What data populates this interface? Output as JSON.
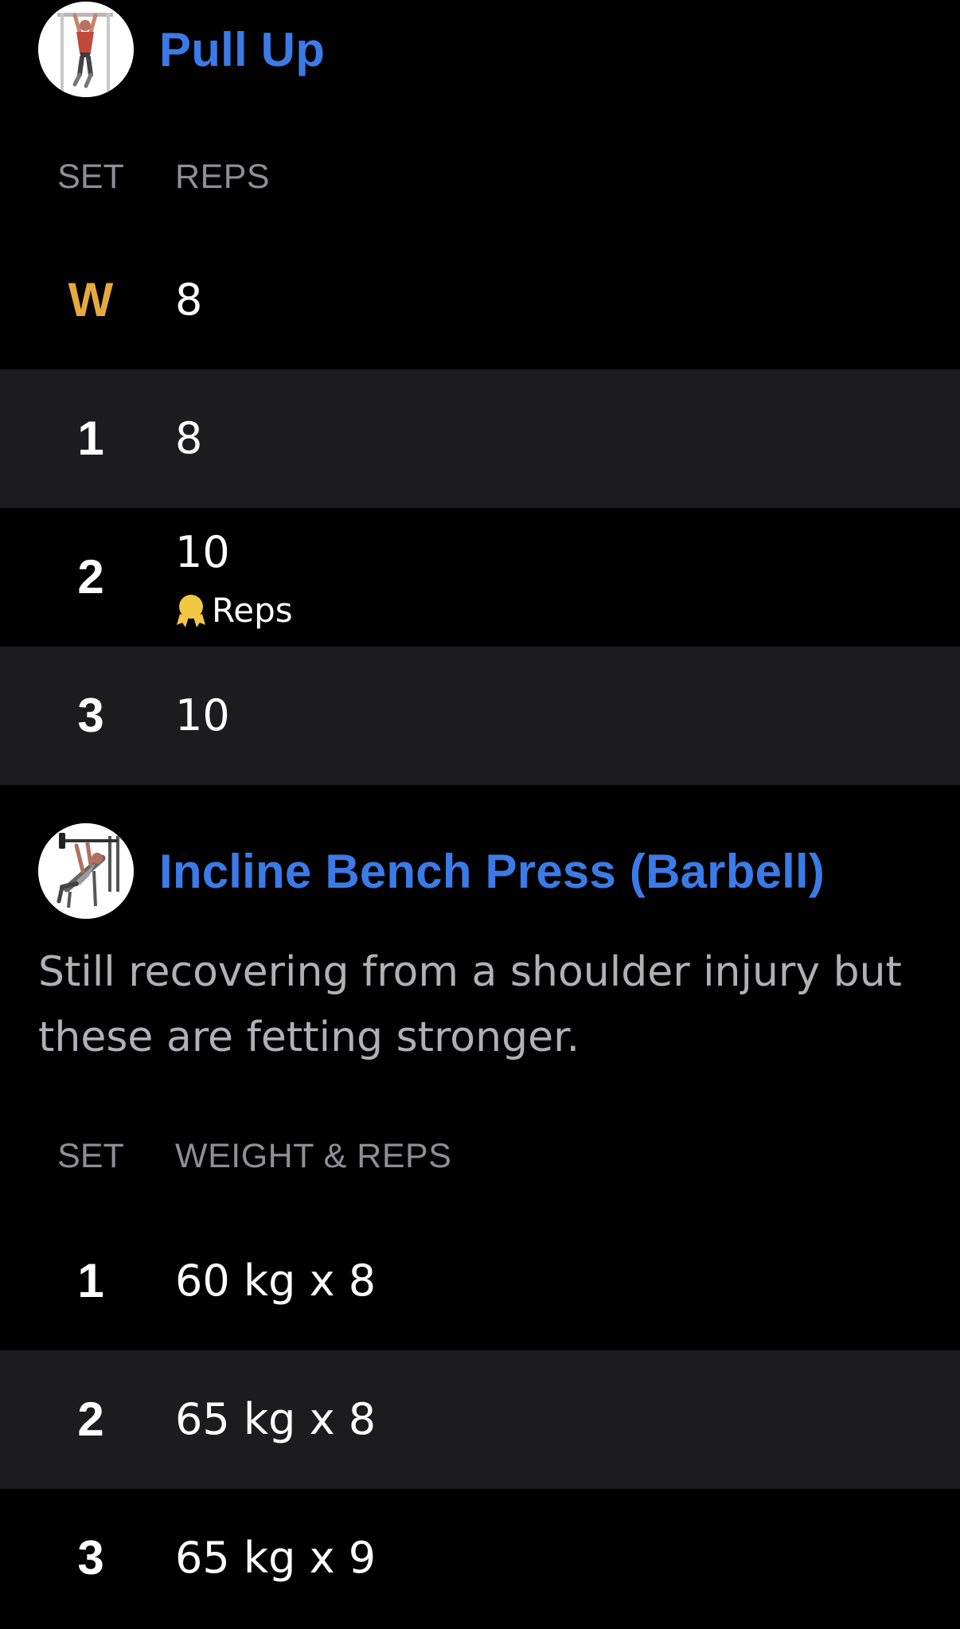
{
  "exercises": [
    {
      "title": "Pull Up",
      "thumbnail_icon": "pull-up-figure-icon",
      "columns": {
        "set": "SET",
        "value": "REPS"
      },
      "sets": [
        {
          "set": "W",
          "value": "8"
        },
        {
          "set": "1",
          "value": "8"
        },
        {
          "set": "2",
          "value": "10",
          "pr_label": "Reps"
        },
        {
          "set": "3",
          "value": "10"
        }
      ]
    },
    {
      "title": "Incline Bench Press (Barbell)",
      "thumbnail_icon": "incline-bench-press-figure-icon",
      "note": "Still recovering from a shoulder injury but these are fetting stronger.",
      "columns": {
        "set": "SET",
        "value": "WEIGHT & REPS"
      },
      "sets": [
        {
          "set": "1",
          "value": "60 kg x 8"
        },
        {
          "set": "2",
          "value": "65 kg x 8"
        },
        {
          "set": "3",
          "value": "65 kg x 9"
        }
      ]
    }
  ],
  "colors": {
    "accent": "#3b7be8",
    "warmup": "#e6a93c",
    "medal": "#f2c744",
    "row_alt": "#1c1c1e",
    "muted": "#8e8e93"
  }
}
